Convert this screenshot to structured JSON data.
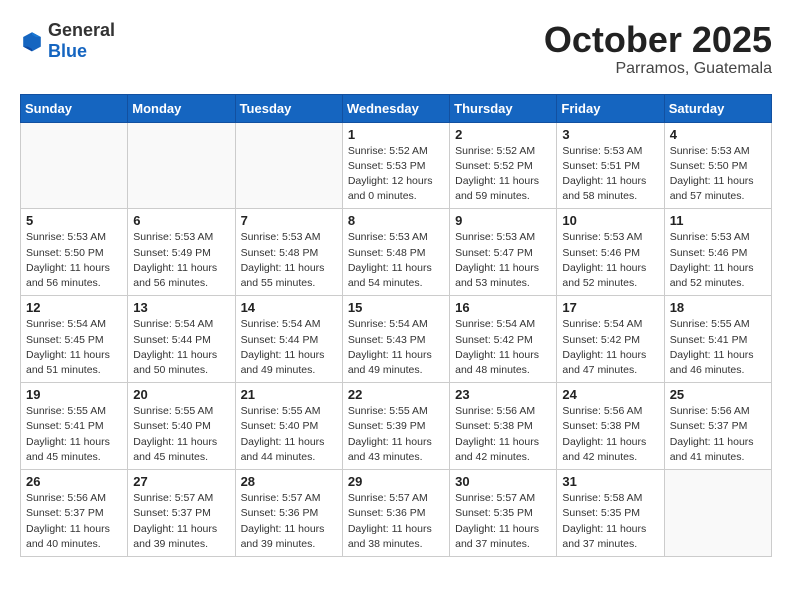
{
  "header": {
    "logo_general": "General",
    "logo_blue": "Blue",
    "month": "October 2025",
    "location": "Parramos, Guatemala"
  },
  "weekdays": [
    "Sunday",
    "Monday",
    "Tuesday",
    "Wednesday",
    "Thursday",
    "Friday",
    "Saturday"
  ],
  "weeks": [
    [
      {
        "day": "",
        "sunrise": "",
        "sunset": "",
        "daylight": ""
      },
      {
        "day": "",
        "sunrise": "",
        "sunset": "",
        "daylight": ""
      },
      {
        "day": "",
        "sunrise": "",
        "sunset": "",
        "daylight": ""
      },
      {
        "day": "1",
        "sunrise": "Sunrise: 5:52 AM",
        "sunset": "Sunset: 5:53 PM",
        "daylight": "Daylight: 12 hours and 0 minutes."
      },
      {
        "day": "2",
        "sunrise": "Sunrise: 5:52 AM",
        "sunset": "Sunset: 5:52 PM",
        "daylight": "Daylight: 11 hours and 59 minutes."
      },
      {
        "day": "3",
        "sunrise": "Sunrise: 5:53 AM",
        "sunset": "Sunset: 5:51 PM",
        "daylight": "Daylight: 11 hours and 58 minutes."
      },
      {
        "day": "4",
        "sunrise": "Sunrise: 5:53 AM",
        "sunset": "Sunset: 5:50 PM",
        "daylight": "Daylight: 11 hours and 57 minutes."
      }
    ],
    [
      {
        "day": "5",
        "sunrise": "Sunrise: 5:53 AM",
        "sunset": "Sunset: 5:50 PM",
        "daylight": "Daylight: 11 hours and 56 minutes."
      },
      {
        "day": "6",
        "sunrise": "Sunrise: 5:53 AM",
        "sunset": "Sunset: 5:49 PM",
        "daylight": "Daylight: 11 hours and 56 minutes."
      },
      {
        "day": "7",
        "sunrise": "Sunrise: 5:53 AM",
        "sunset": "Sunset: 5:48 PM",
        "daylight": "Daylight: 11 hours and 55 minutes."
      },
      {
        "day": "8",
        "sunrise": "Sunrise: 5:53 AM",
        "sunset": "Sunset: 5:48 PM",
        "daylight": "Daylight: 11 hours and 54 minutes."
      },
      {
        "day": "9",
        "sunrise": "Sunrise: 5:53 AM",
        "sunset": "Sunset: 5:47 PM",
        "daylight": "Daylight: 11 hours and 53 minutes."
      },
      {
        "day": "10",
        "sunrise": "Sunrise: 5:53 AM",
        "sunset": "Sunset: 5:46 PM",
        "daylight": "Daylight: 11 hours and 52 minutes."
      },
      {
        "day": "11",
        "sunrise": "Sunrise: 5:53 AM",
        "sunset": "Sunset: 5:46 PM",
        "daylight": "Daylight: 11 hours and 52 minutes."
      }
    ],
    [
      {
        "day": "12",
        "sunrise": "Sunrise: 5:54 AM",
        "sunset": "Sunset: 5:45 PM",
        "daylight": "Daylight: 11 hours and 51 minutes."
      },
      {
        "day": "13",
        "sunrise": "Sunrise: 5:54 AM",
        "sunset": "Sunset: 5:44 PM",
        "daylight": "Daylight: 11 hours and 50 minutes."
      },
      {
        "day": "14",
        "sunrise": "Sunrise: 5:54 AM",
        "sunset": "Sunset: 5:44 PM",
        "daylight": "Daylight: 11 hours and 49 minutes."
      },
      {
        "day": "15",
        "sunrise": "Sunrise: 5:54 AM",
        "sunset": "Sunset: 5:43 PM",
        "daylight": "Daylight: 11 hours and 49 minutes."
      },
      {
        "day": "16",
        "sunrise": "Sunrise: 5:54 AM",
        "sunset": "Sunset: 5:42 PM",
        "daylight": "Daylight: 11 hours and 48 minutes."
      },
      {
        "day": "17",
        "sunrise": "Sunrise: 5:54 AM",
        "sunset": "Sunset: 5:42 PM",
        "daylight": "Daylight: 11 hours and 47 minutes."
      },
      {
        "day": "18",
        "sunrise": "Sunrise: 5:55 AM",
        "sunset": "Sunset: 5:41 PM",
        "daylight": "Daylight: 11 hours and 46 minutes."
      }
    ],
    [
      {
        "day": "19",
        "sunrise": "Sunrise: 5:55 AM",
        "sunset": "Sunset: 5:41 PM",
        "daylight": "Daylight: 11 hours and 45 minutes."
      },
      {
        "day": "20",
        "sunrise": "Sunrise: 5:55 AM",
        "sunset": "Sunset: 5:40 PM",
        "daylight": "Daylight: 11 hours and 45 minutes."
      },
      {
        "day": "21",
        "sunrise": "Sunrise: 5:55 AM",
        "sunset": "Sunset: 5:40 PM",
        "daylight": "Daylight: 11 hours and 44 minutes."
      },
      {
        "day": "22",
        "sunrise": "Sunrise: 5:55 AM",
        "sunset": "Sunset: 5:39 PM",
        "daylight": "Daylight: 11 hours and 43 minutes."
      },
      {
        "day": "23",
        "sunrise": "Sunrise: 5:56 AM",
        "sunset": "Sunset: 5:38 PM",
        "daylight": "Daylight: 11 hours and 42 minutes."
      },
      {
        "day": "24",
        "sunrise": "Sunrise: 5:56 AM",
        "sunset": "Sunset: 5:38 PM",
        "daylight": "Daylight: 11 hours and 42 minutes."
      },
      {
        "day": "25",
        "sunrise": "Sunrise: 5:56 AM",
        "sunset": "Sunset: 5:37 PM",
        "daylight": "Daylight: 11 hours and 41 minutes."
      }
    ],
    [
      {
        "day": "26",
        "sunrise": "Sunrise: 5:56 AM",
        "sunset": "Sunset: 5:37 PM",
        "daylight": "Daylight: 11 hours and 40 minutes."
      },
      {
        "day": "27",
        "sunrise": "Sunrise: 5:57 AM",
        "sunset": "Sunset: 5:37 PM",
        "daylight": "Daylight: 11 hours and 39 minutes."
      },
      {
        "day": "28",
        "sunrise": "Sunrise: 5:57 AM",
        "sunset": "Sunset: 5:36 PM",
        "daylight": "Daylight: 11 hours and 39 minutes."
      },
      {
        "day": "29",
        "sunrise": "Sunrise: 5:57 AM",
        "sunset": "Sunset: 5:36 PM",
        "daylight": "Daylight: 11 hours and 38 minutes."
      },
      {
        "day": "30",
        "sunrise": "Sunrise: 5:57 AM",
        "sunset": "Sunset: 5:35 PM",
        "daylight": "Daylight: 11 hours and 37 minutes."
      },
      {
        "day": "31",
        "sunrise": "Sunrise: 5:58 AM",
        "sunset": "Sunset: 5:35 PM",
        "daylight": "Daylight: 11 hours and 37 minutes."
      },
      {
        "day": "",
        "sunrise": "",
        "sunset": "",
        "daylight": ""
      }
    ]
  ]
}
